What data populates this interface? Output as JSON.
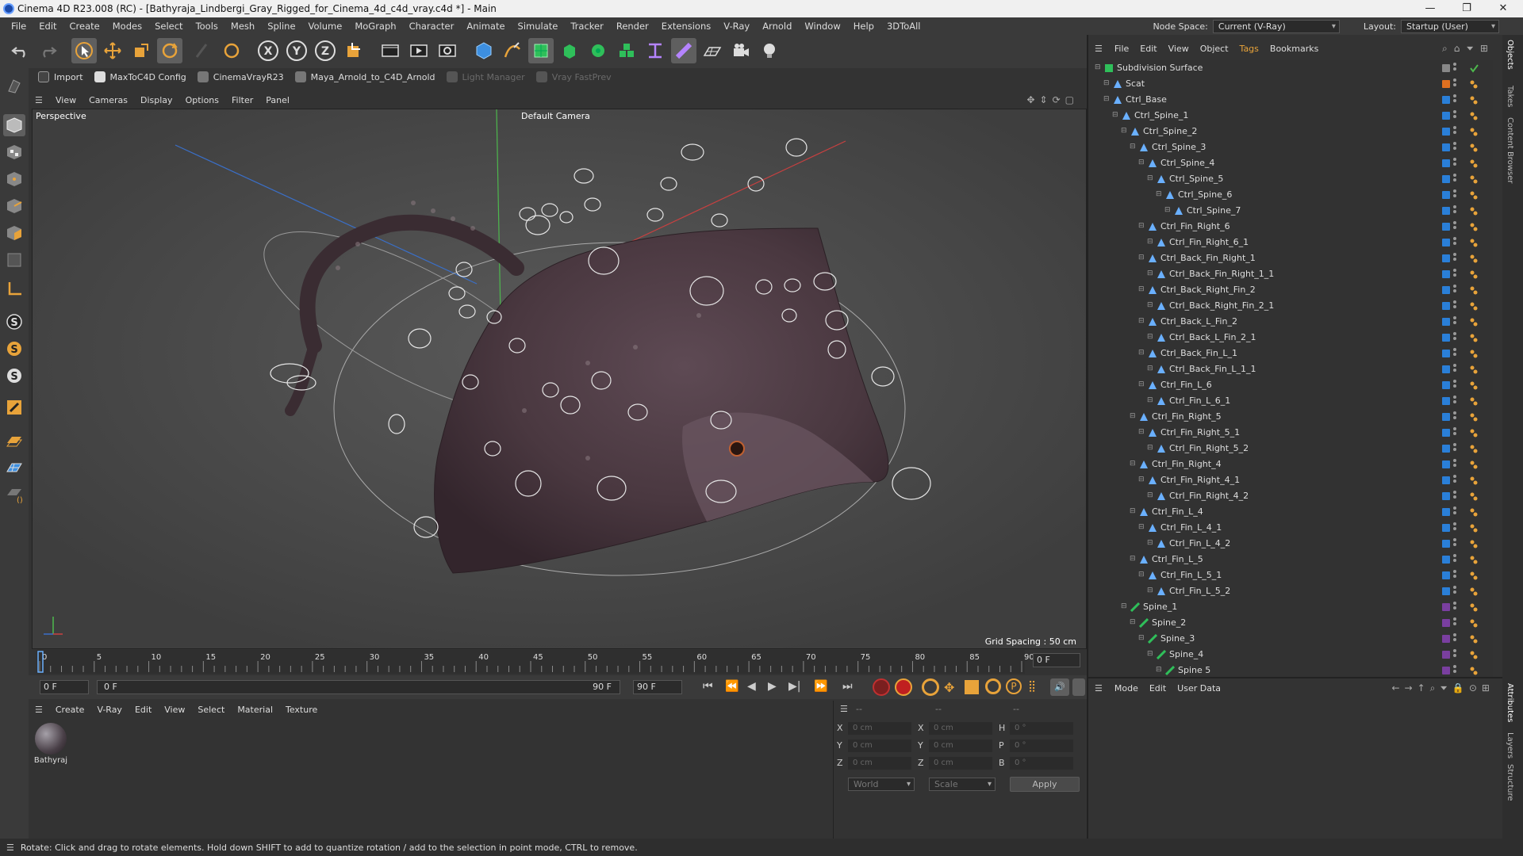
{
  "window": {
    "title": "Cinema 4D R23.008 (RC) - [Bathyraja_Lindbergi_Gray_Rigged_for_Cinema_4d_c4d_vray.c4d *] - Main",
    "minimize": "—",
    "maximize": "❐",
    "close": "✕"
  },
  "menu": [
    "File",
    "Edit",
    "Create",
    "Modes",
    "Select",
    "Tools",
    "Mesh",
    "Spline",
    "Volume",
    "MoGraph",
    "Character",
    "Animate",
    "Simulate",
    "Tracker",
    "Render",
    "Extensions",
    "V-Ray",
    "Arnold",
    "Window",
    "Help",
    "3DToAll"
  ],
  "node_space": {
    "label": "Node Space:",
    "value": "Current (V-Ray)"
  },
  "layout": {
    "label": "Layout:",
    "value": "Startup (User)"
  },
  "plugins": [
    {
      "label": "Import",
      "enabled": true
    },
    {
      "label": "MaxToC4D Config",
      "enabled": true
    },
    {
      "label": "CinemaVrayR23",
      "enabled": true
    },
    {
      "label": "Maya_Arnold_to_C4D_Arnold",
      "enabled": true
    },
    {
      "label": "Light Manager",
      "enabled": false
    },
    {
      "label": "Vray FastPrev",
      "enabled": false
    }
  ],
  "viewport": {
    "menu": [
      "View",
      "Cameras",
      "Display",
      "Options",
      "Filter",
      "Panel"
    ],
    "name": "Perspective",
    "camera": "Default Camera",
    "grid_spacing": "Grid Spacing : 50 cm"
  },
  "timeline": {
    "ticks": [
      "0",
      "5",
      "10",
      "15",
      "20",
      "25",
      "30",
      "35",
      "40",
      "45",
      "50",
      "55",
      "60",
      "65",
      "70",
      "75",
      "80",
      "85",
      "90"
    ],
    "current_frame": "0 F",
    "start": "0 F",
    "range_start": "0 F",
    "range_end": "90 F",
    "end": "90 F"
  },
  "material_manager": {
    "menu": [
      "Create",
      "V-Ray",
      "Edit",
      "View",
      "Select",
      "Material",
      "Texture"
    ],
    "materials": [
      {
        "name": "Bathyraj"
      }
    ]
  },
  "coordinates": {
    "header": [
      "--",
      "--",
      "--"
    ],
    "rows": [
      {
        "a": "X",
        "av": "0 cm",
        "b": "X",
        "bv": "0 cm",
        "c": "H",
        "cv": "0 °"
      },
      {
        "a": "Y",
        "av": "0 cm",
        "b": "Y",
        "bv": "0 cm",
        "c": "P",
        "cv": "0 °"
      },
      {
        "a": "Z",
        "av": "0 cm",
        "b": "Z",
        "bv": "0 cm",
        "c": "B",
        "cv": "0 °"
      }
    ],
    "mode": "World",
    "scale_mode": "Scale",
    "apply": "Apply"
  },
  "object_manager": {
    "menu": [
      "File",
      "Edit",
      "View",
      "Object",
      "Tags",
      "Bookmarks"
    ],
    "objects": [
      {
        "name": "Subdivision Surface",
        "depth": 0,
        "type": "sds",
        "color": "#888888"
      },
      {
        "name": "Scat",
        "depth": 1,
        "type": "poly",
        "color": "#e07020"
      },
      {
        "name": "Ctrl_Base",
        "depth": 1,
        "type": "joint",
        "color": "#2a7fd8"
      },
      {
        "name": "Ctrl_Spine_1",
        "depth": 2,
        "type": "joint",
        "color": "#2a7fd8"
      },
      {
        "name": "Ctrl_Spine_2",
        "depth": 3,
        "type": "joint",
        "color": "#2a7fd8"
      },
      {
        "name": "Ctrl_Spine_3",
        "depth": 4,
        "type": "joint",
        "color": "#2a7fd8"
      },
      {
        "name": "Ctrl_Spine_4",
        "depth": 5,
        "type": "joint",
        "color": "#2a7fd8"
      },
      {
        "name": "Ctrl_Spine_5",
        "depth": 6,
        "type": "joint",
        "color": "#2a7fd8"
      },
      {
        "name": "Ctrl_Spine_6",
        "depth": 7,
        "type": "joint",
        "color": "#2a7fd8"
      },
      {
        "name": "Ctrl_Spine_7",
        "depth": 8,
        "type": "joint",
        "color": "#2a7fd8"
      },
      {
        "name": "Ctrl_Fin_Right_6",
        "depth": 5,
        "type": "joint",
        "color": "#2a7fd8"
      },
      {
        "name": "Ctrl_Fin_Right_6_1",
        "depth": 6,
        "type": "joint",
        "color": "#2a7fd8"
      },
      {
        "name": "Ctrl_Back_Fin_Right_1",
        "depth": 5,
        "type": "joint",
        "color": "#2a7fd8"
      },
      {
        "name": "Ctrl_Back_Fin_Right_1_1",
        "depth": 6,
        "type": "joint",
        "color": "#2a7fd8"
      },
      {
        "name": "Ctrl_Back_Right_Fin_2",
        "depth": 5,
        "type": "joint",
        "color": "#2a7fd8"
      },
      {
        "name": "Ctrl_Back_Right_Fin_2_1",
        "depth": 6,
        "type": "joint",
        "color": "#2a7fd8"
      },
      {
        "name": "Ctrl_Back_L_Fin_2",
        "depth": 5,
        "type": "joint",
        "color": "#2a7fd8"
      },
      {
        "name": "Ctrl_Back_L_Fin_2_1",
        "depth": 6,
        "type": "joint",
        "color": "#2a7fd8"
      },
      {
        "name": "Ctrl_Back_Fin_L_1",
        "depth": 5,
        "type": "joint",
        "color": "#2a7fd8"
      },
      {
        "name": "Ctrl_Back_Fin_L_1_1",
        "depth": 6,
        "type": "joint",
        "color": "#2a7fd8"
      },
      {
        "name": "Ctrl_Fin_L_6",
        "depth": 5,
        "type": "joint",
        "color": "#2a7fd8"
      },
      {
        "name": "Ctrl_Fin_L_6_1",
        "depth": 6,
        "type": "joint",
        "color": "#2a7fd8"
      },
      {
        "name": "Ctrl_Fin_Right_5",
        "depth": 4,
        "type": "joint",
        "color": "#2a7fd8"
      },
      {
        "name": "Ctrl_Fin_Right_5_1",
        "depth": 5,
        "type": "joint",
        "color": "#2a7fd8"
      },
      {
        "name": "Ctrl_Fin_Right_5_2",
        "depth": 6,
        "type": "joint",
        "color": "#2a7fd8"
      },
      {
        "name": "Ctrl_Fin_Right_4",
        "depth": 4,
        "type": "joint",
        "color": "#2a7fd8"
      },
      {
        "name": "Ctrl_Fin_Right_4_1",
        "depth": 5,
        "type": "joint",
        "color": "#2a7fd8"
      },
      {
        "name": "Ctrl_Fin_Right_4_2",
        "depth": 6,
        "type": "joint",
        "color": "#2a7fd8"
      },
      {
        "name": "Ctrl_Fin_L_4",
        "depth": 4,
        "type": "joint",
        "color": "#2a7fd8"
      },
      {
        "name": "Ctrl_Fin_L_4_1",
        "depth": 5,
        "type": "joint",
        "color": "#2a7fd8"
      },
      {
        "name": "Ctrl_Fin_L_4_2",
        "depth": 6,
        "type": "joint",
        "color": "#2a7fd8"
      },
      {
        "name": "Ctrl_Fin_L_5",
        "depth": 4,
        "type": "joint",
        "color": "#2a7fd8"
      },
      {
        "name": "Ctrl_Fin_L_5_1",
        "depth": 5,
        "type": "joint",
        "color": "#2a7fd8"
      },
      {
        "name": "Ctrl_Fin_L_5_2",
        "depth": 6,
        "type": "joint",
        "color": "#2a7fd8"
      },
      {
        "name": "Spine_1",
        "depth": 3,
        "type": "bone",
        "color": "#7a3fa0"
      },
      {
        "name": "Spine_2",
        "depth": 4,
        "type": "bone",
        "color": "#7a3fa0"
      },
      {
        "name": "Spine_3",
        "depth": 5,
        "type": "bone",
        "color": "#7a3fa0"
      },
      {
        "name": "Spine_4",
        "depth": 6,
        "type": "bone",
        "color": "#7a3fa0"
      },
      {
        "name": "Spine 5",
        "depth": 7,
        "type": "bone",
        "color": "#7a3fa0"
      }
    ]
  },
  "attributes": {
    "menu": [
      "Mode",
      "Edit",
      "User Data"
    ]
  },
  "right_tabs": [
    "Objects",
    "Takes",
    "Content Browser",
    "Attributes",
    "Layers",
    "Structure"
  ],
  "status": "Rotate: Click and drag to rotate elements. Hold down SHIFT to add to quantize rotation / add to the selection in point mode, CTRL to remove.",
  "colors": {
    "accent": "#e8a33a",
    "joint": "#2a7fd8",
    "bone": "#7a3fa0",
    "scat": "#e07020"
  }
}
